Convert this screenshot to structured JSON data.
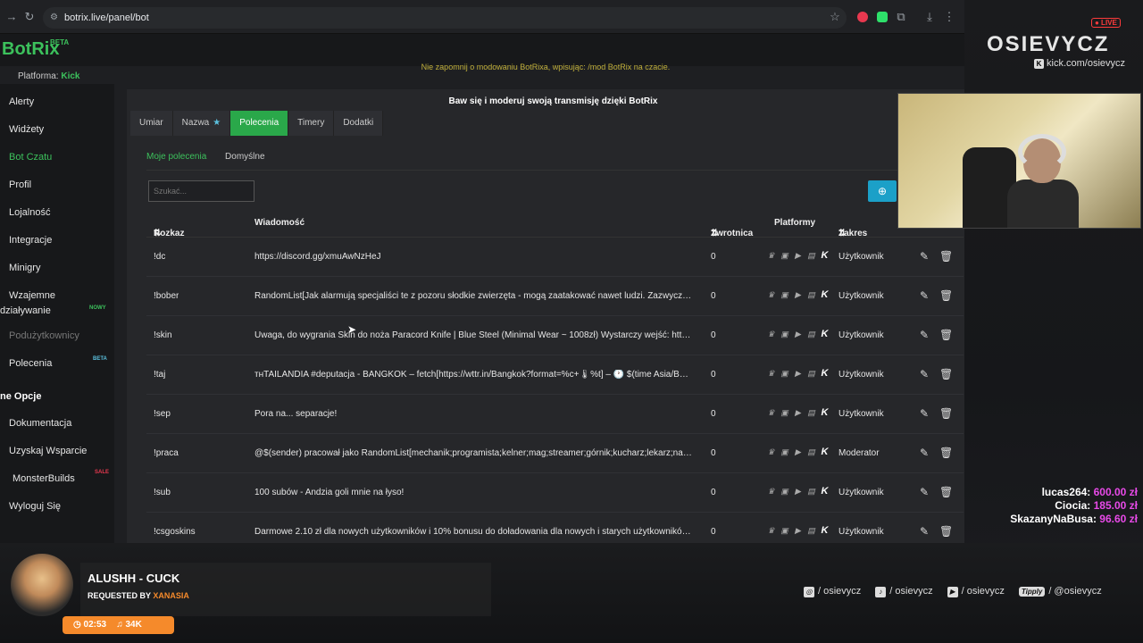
{
  "browser": {
    "url": "botrix.live/panel/bot"
  },
  "app": {
    "brand": "BotRix",
    "brand_badge": "BETA",
    "platform_label": "Platforma:",
    "platform_value": "Kick",
    "notice": "Nie zapomnij o modowaniu BotRixa, wpisując: /mod BotRix na czacie."
  },
  "sidebar": {
    "items": [
      {
        "label": "Alerty"
      },
      {
        "label": "Widżety"
      },
      {
        "label": "Bot Czatu"
      },
      {
        "label": "Profil"
      },
      {
        "label": "Lojalność"
      },
      {
        "label": "Integracje"
      },
      {
        "label": "Minigry"
      },
      {
        "label": "Wzajemne"
      },
      {
        "label": "działywanie"
      },
      {
        "label": "Podużytkownicy"
      },
      {
        "label": "Polecenia"
      }
    ],
    "badge_new": "NOWY",
    "badge_beta": "BETA",
    "section": "ne Opcje",
    "options": [
      {
        "label": "Dokumentacja"
      },
      {
        "label": "Uzyskaj Wsparcie"
      },
      {
        "label": "MonsterBuilds"
      },
      {
        "label": "Wyloguj Się"
      }
    ],
    "badge_sale": "SALE"
  },
  "panel": {
    "title": "Baw się i moderuj swoją transmisję dzięki BotRix",
    "tabs": [
      {
        "label": "Umiar"
      },
      {
        "label": "Nazwa"
      },
      {
        "label": "Polecenia"
      },
      {
        "label": "Timery"
      },
      {
        "label": "Dodatki"
      }
    ],
    "subtabs": [
      {
        "label": "Moje polecenia"
      },
      {
        "label": "Domyślne"
      }
    ],
    "search_placeholder": "Szukać..."
  },
  "table": {
    "headers": {
      "command": "Rozkaz",
      "message": "Wiadomość",
      "cooldown": "Zwrotnica",
      "platforms": "Platformy",
      "scope": "Zakres"
    },
    "rows": [
      {
        "command": "!dc",
        "message": "https://discord.gg/xmuAwNzHeJ",
        "cooldown": "0",
        "scope": "Użytkownik"
      },
      {
        "command": "!bober",
        "message": "RandomList[Jak alarmują specjaliści te z pozoru słodkie zwierzęta - mogą zaatakować nawet ludzi. Zazwyczaj robią t...",
        "cooldown": "0",
        "scope": "Użytkownik"
      },
      {
        "command": "!skin",
        "message": "Uwaga, do wygrania Skin do noża Paracord Knife | Blue Steel (Minimal Wear ~ 1008zł) Wystarczy wejść: https://csgo...",
        "cooldown": "0",
        "scope": "Użytkownik"
      },
      {
        "command": "!taj",
        "message": "ᴛʜTAILANDIA #deputacja - BANGKOK – fetch[https://wttr.in/Bangkok?format=%c+🌡%t] – 🕐 $(time Asia/Bangkok ...",
        "cooldown": "0",
        "scope": "Użytkownik"
      },
      {
        "command": "!sep",
        "message": "Pora na... separacje!",
        "cooldown": "0",
        "scope": "Użytkownik"
      },
      {
        "command": "!praca",
        "message": "@$(sender) pracował jako RandomList[mechanik;programista;kelner;mag;streamer;górnik;kucharz;lekarz;nauczyciel;...",
        "cooldown": "0",
        "scope": "Moderator"
      },
      {
        "command": "!sub",
        "message": "100 subów - Andzia goli mnie na łyso!",
        "cooldown": "0",
        "scope": "Użytkownik"
      },
      {
        "command": "!csgoskins",
        "message": "Darmowe 2.10 zł dla nowych użytkowników i 10% bonusu do doładowania dla nowych i starych użytkowników z ko...",
        "cooldown": "0",
        "scope": "Użytkownik"
      }
    ]
  },
  "overlay": {
    "channel_name": "OSIEVYCZ",
    "live": "● LIVE",
    "kick_handle": "kick.com/osievycz",
    "donors": [
      {
        "name": "lucas264:",
        "amount": "600.00 zł"
      },
      {
        "name": "Ciocia:",
        "amount": "185.00 zł"
      },
      {
        "name": "SkazanyNaBusa:",
        "amount": "96.60 zł"
      }
    ],
    "song_title": "ALUSHH - CUCK",
    "requested_by": "REQUESTED BY",
    "requester": "XANASIA",
    "time": "02:53",
    "plays": "34K",
    "socials": [
      {
        "label": "/ osievycz"
      },
      {
        "label": "/ osievycz"
      },
      {
        "label": "/ osievycz"
      },
      {
        "label": "/ @osievycz"
      }
    ],
    "tipply": "Tipply"
  },
  "colors": {
    "accent": "#3cc15c",
    "tab_active": "#2aa84a",
    "add_button": "#1ba0c8",
    "donation": "#e84ae8",
    "song_badge": "#f58a2b"
  }
}
